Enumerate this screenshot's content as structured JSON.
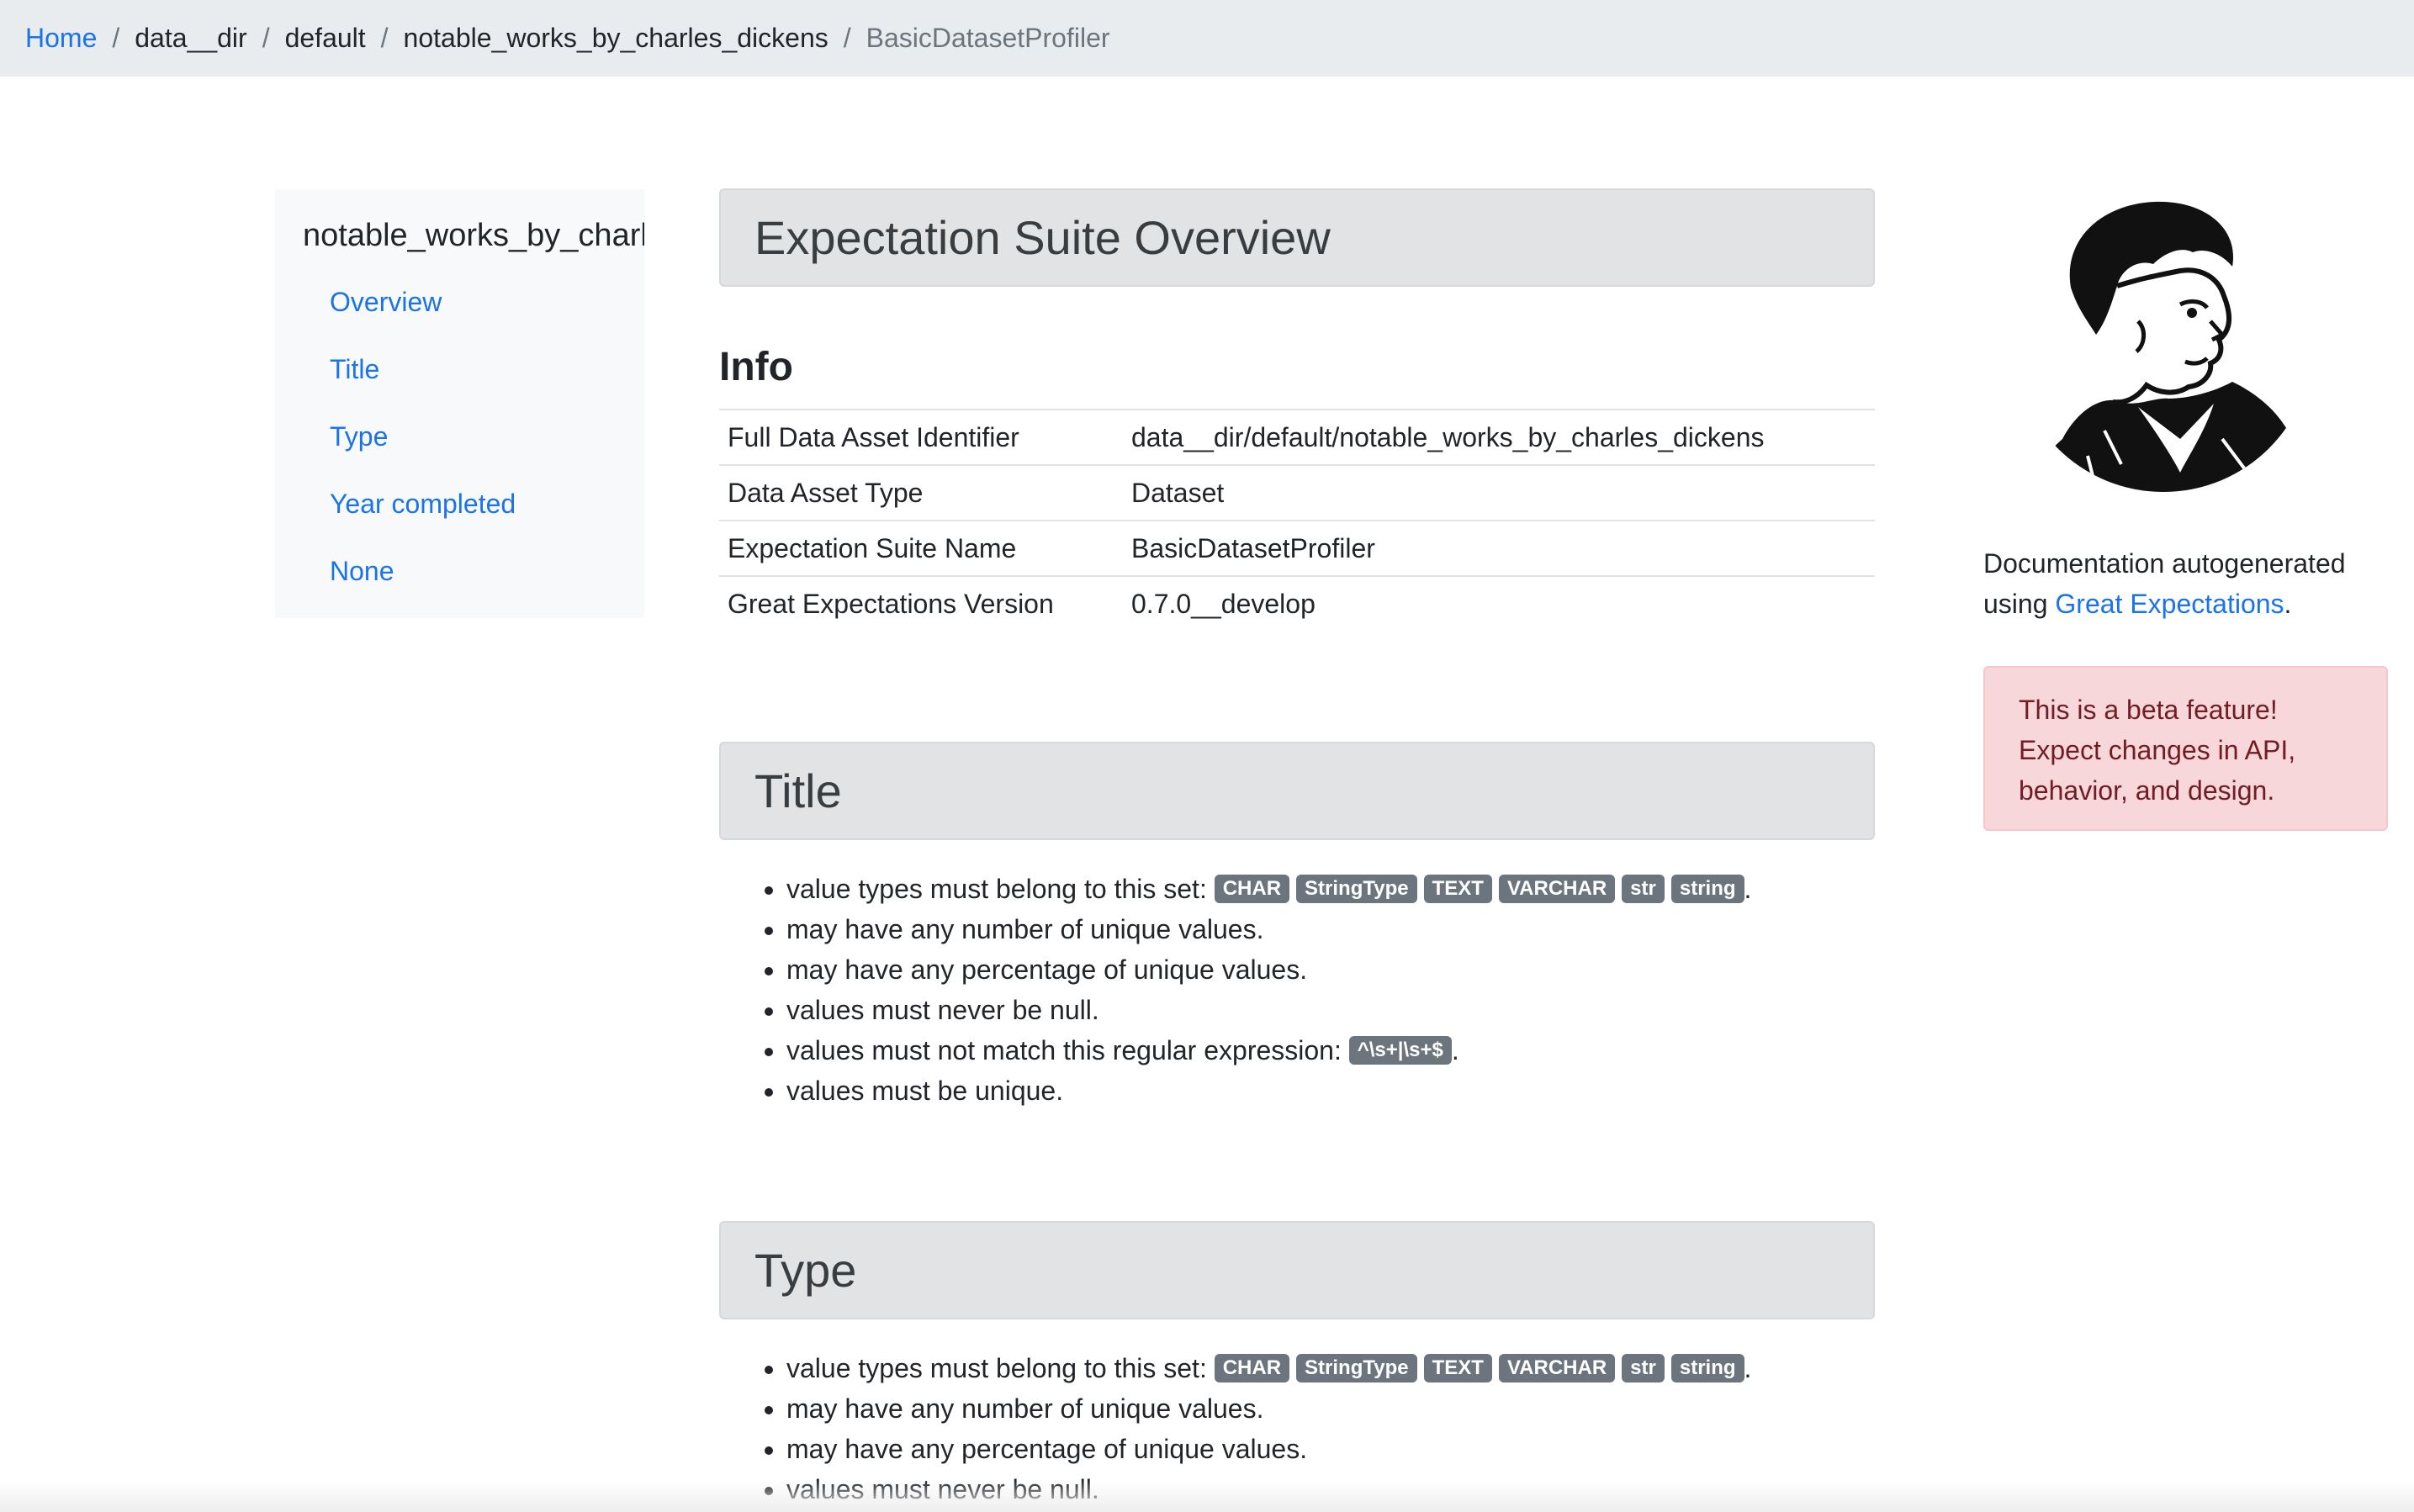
{
  "breadcrumb": {
    "items": [
      "Home",
      "data__dir",
      "default",
      "notable_works_by_charles_dickens",
      "BasicDatasetProfiler"
    ],
    "separator": "/"
  },
  "sidenav": {
    "title": "notable_works_by_charles_dickens",
    "items": [
      "Overview",
      "Title",
      "Type",
      "Year completed",
      "None"
    ]
  },
  "overview": {
    "header": "Expectation Suite Overview",
    "info_heading": "Info",
    "rows": [
      {
        "key": "Full Data Asset Identifier",
        "value": "data__dir/default/notable_works_by_charles_dickens"
      },
      {
        "key": "Data Asset Type",
        "value": "Dataset"
      },
      {
        "key": "Expectation Suite Name",
        "value": "BasicDatasetProfiler"
      },
      {
        "key": "Great Expectations Version",
        "value": "0.7.0__develop"
      }
    ]
  },
  "title_section": {
    "header": "Title",
    "value_types_text": "value types must belong to this set: ",
    "type_badges": [
      "CHAR",
      "StringType",
      "TEXT",
      "VARCHAR",
      "str",
      "string"
    ],
    "unique_count_text": "may have any number of unique values.",
    "unique_pct_text": "may have any percentage of unique values.",
    "not_null_text": "values must never be null.",
    "regex_text": "values must not match this regular expression: ",
    "regex_badge": "^\\s+|\\s+$",
    "unique_text": "values must be unique."
  },
  "type_section": {
    "header": "Type",
    "value_types_text": "value types must belong to this set: ",
    "type_badges": [
      "CHAR",
      "StringType",
      "TEXT",
      "VARCHAR",
      "str",
      "string"
    ],
    "unique_count_text": "may have any number of unique values.",
    "unique_pct_text": "may have any percentage of unique values.",
    "not_null_text": "values must never be null."
  },
  "sidebar_right": {
    "doc_text_1": "Documentation autogenerated",
    "doc_text_2": "using ",
    "doc_link": "Great Expectations",
    "doc_period": ".",
    "beta_line_1": "This is a beta feature!",
    "beta_line_2": "Expect changes in API,",
    "beta_line_3": "behavior, and design."
  },
  "colors": {
    "link": "#1a73e8",
    "badge": "#6c757d",
    "section_header_bg": "#e2e3e5",
    "beta_bg": "#f8d7da",
    "beta_text": "#721c24"
  }
}
